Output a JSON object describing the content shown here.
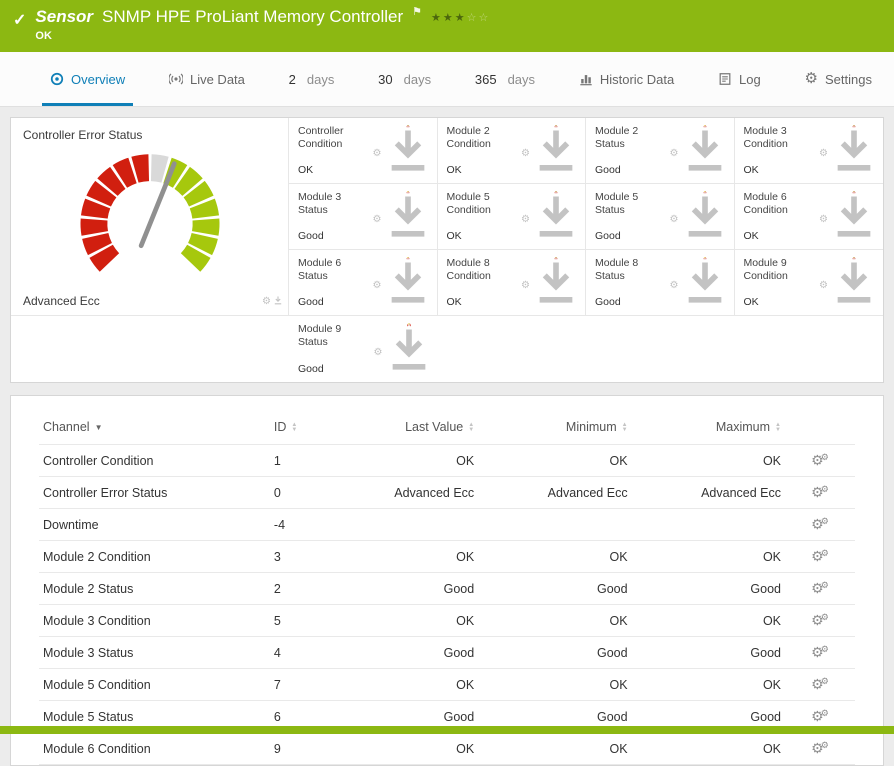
{
  "colors": {
    "header_green": "#8cb812",
    "tab_active_blue": "#0f7fb7",
    "gauge_red": "#d11f0f",
    "gauge_lime": "#a6c80d",
    "gauge_yellow": "#e3c40f",
    "gauge_gray": "#d9d9d9",
    "needle_gray": "#909090"
  },
  "header": {
    "kind": "Sensor",
    "title": "SNMP HPE ProLiant Memory Controller",
    "status": "OK",
    "rating": 3,
    "rating_max": 5
  },
  "tabs": [
    {
      "label": "Overview",
      "icon": "overview",
      "active": true
    },
    {
      "label": "Live Data",
      "icon": "live",
      "active": false
    },
    {
      "number": "2",
      "unit": "days",
      "active": false
    },
    {
      "number": "30",
      "unit": "days",
      "active": false
    },
    {
      "number": "365",
      "unit": "days",
      "active": false
    },
    {
      "label": "Historic Data",
      "icon": "historic",
      "active": false
    },
    {
      "label": "Log",
      "icon": "log",
      "active": false
    },
    {
      "label": "Settings",
      "icon": "settings",
      "active": false
    }
  ],
  "gauges": {
    "big": {
      "title": "Controller Error Status",
      "value": "Advanced Ecc",
      "segments": [
        "red",
        "red",
        "red",
        "red",
        "red",
        "red",
        "red",
        "red",
        "gray",
        "lime",
        "lime",
        "lime",
        "lime",
        "lime",
        "lime",
        "lime"
      ],
      "needle_deg": 22
    },
    "types": {
      "condition": {
        "segments": [
          "red",
          "red",
          "red",
          "red",
          "lime",
          "lime",
          "red",
          "red",
          "red",
          "red"
        ],
        "needle_deg": 33
      },
      "status": {
        "segments": [
          "red",
          "red",
          "red",
          "yellow",
          "yellow",
          "yellow",
          "red",
          "red",
          "red",
          "red"
        ],
        "needle_deg": 33
      }
    },
    "small": [
      {
        "title": "Controller Condition",
        "value": "OK",
        "type": "condition"
      },
      {
        "title": "Module 2 Condition",
        "value": "OK",
        "type": "condition"
      },
      {
        "title": "Module 2 Status",
        "value": "Good",
        "type": "status"
      },
      {
        "title": "Module 3 Condition",
        "value": "OK",
        "type": "condition"
      },
      {
        "title": "Module 3 Status",
        "value": "Good",
        "type": "status"
      },
      {
        "title": "Module 5 Condition",
        "value": "OK",
        "type": "condition"
      },
      {
        "title": "Module 5 Status",
        "value": "Good",
        "type": "status"
      },
      {
        "title": "Module 6 Condition",
        "value": "OK",
        "type": "condition"
      },
      {
        "title": "Module 6 Status",
        "value": "Good",
        "type": "status"
      },
      {
        "title": "Module 8 Condition",
        "value": "OK",
        "type": "condition"
      },
      {
        "title": "Module 8 Status",
        "value": "Good",
        "type": "status"
      },
      {
        "title": "Module 9 Condition",
        "value": "OK",
        "type": "condition"
      },
      {
        "title": "Module 9 Status",
        "value": "Good",
        "type": "status"
      }
    ]
  },
  "table": {
    "columns": [
      {
        "label": "Channel",
        "sorted": true,
        "align": "left"
      },
      {
        "label": "ID",
        "align": "left"
      },
      {
        "label": "Last Value",
        "align": "right"
      },
      {
        "label": "Minimum",
        "align": "right"
      },
      {
        "label": "Maximum",
        "align": "right"
      }
    ],
    "rows": [
      [
        "Controller Condition",
        "1",
        "OK",
        "OK",
        "OK"
      ],
      [
        "Controller Error Status",
        "0",
        "Advanced Ecc",
        "Advanced Ecc",
        "Advanced Ecc"
      ],
      [
        "Downtime",
        "-4",
        "",
        "",
        ""
      ],
      [
        "Module 2 Condition",
        "3",
        "OK",
        "OK",
        "OK"
      ],
      [
        "Module 2 Status",
        "2",
        "Good",
        "Good",
        "Good"
      ],
      [
        "Module 3 Condition",
        "5",
        "OK",
        "OK",
        "OK"
      ],
      [
        "Module 3 Status",
        "4",
        "Good",
        "Good",
        "Good"
      ],
      [
        "Module 5 Condition",
        "7",
        "OK",
        "OK",
        "OK"
      ],
      [
        "Module 5 Status",
        "6",
        "Good",
        "Good",
        "Good"
      ],
      [
        "Module 6 Condition",
        "9",
        "OK",
        "OK",
        "OK"
      ]
    ]
  }
}
